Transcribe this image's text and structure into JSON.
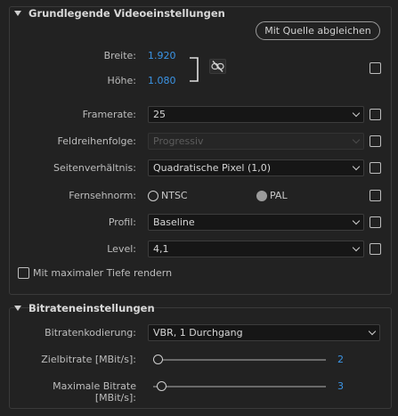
{
  "video": {
    "title": "Grundlegende Videoeinstellungen",
    "match_source_label": "Mit Quelle abgleichen",
    "width_label": "Breite:",
    "width_value": "1.920",
    "height_label": "Höhe:",
    "height_value": "1.080",
    "framerate_label": "Framerate:",
    "framerate_value": "25",
    "field_order_label": "Feldreihenfolge:",
    "field_order_value": "Progressiv",
    "aspect_label": "Seitenverhältnis:",
    "aspect_value": "Quadratische Pixel (1,0)",
    "tv_standard_label": "Fernsehnorm:",
    "tv_ntsc": "NTSC",
    "tv_pal": "PAL",
    "tv_selected": "PAL",
    "profile_label": "Profil:",
    "profile_value": "Baseline",
    "level_label": "Level:",
    "level_value": "4,1",
    "max_depth_label": "Mit maximaler Tiefe rendern"
  },
  "bitrate": {
    "title": "Bitrateneinstellungen",
    "encoding_label": "Bitratenkodierung:",
    "encoding_value": "VBR, 1 Durchgang",
    "target_label": "Zielbitrate [MBit/s]:",
    "target_value": "2",
    "max_label": "Maximale Bitrate [MBit/s]:",
    "max_value": "3"
  },
  "icons": {
    "section_toggle": "caret-down-icon",
    "link": "unlink-icon",
    "dropdown": "chevron-down-icon"
  },
  "colors": {
    "background": "#222222",
    "accent_value": "#3b95e6"
  }
}
